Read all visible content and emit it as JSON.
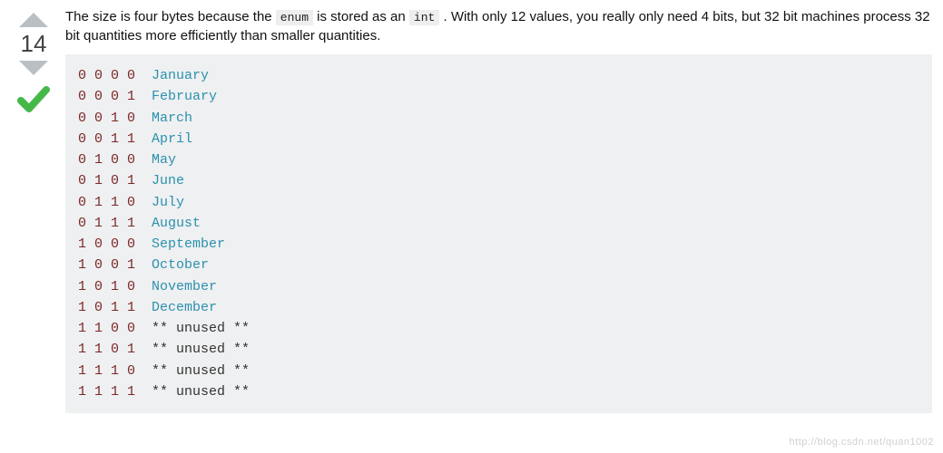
{
  "vote": {
    "score": "14"
  },
  "answer": {
    "text_part1": "The size is four bytes because the ",
    "code1": "enum",
    "text_part2": " is stored as an ",
    "code2": "int",
    "text_part3": " . With only 12 values, you really only need 4 bits, but 32 bit machines process 32 bit quantities more efficiently than smaller quantities."
  },
  "code_rows": [
    {
      "bits": "0 0 0 0  ",
      "label": "January",
      "labelClass": "teal"
    },
    {
      "bits": "0 0 0 1  ",
      "label": "February",
      "labelClass": "teal"
    },
    {
      "bits": "0 0 1 0  ",
      "label": "March",
      "labelClass": "teal"
    },
    {
      "bits": "0 0 1 1  ",
      "label": "April",
      "labelClass": "teal"
    },
    {
      "bits": "0 1 0 0  ",
      "label": "May",
      "labelClass": "teal"
    },
    {
      "bits": "0 1 0 1  ",
      "label": "June",
      "labelClass": "teal"
    },
    {
      "bits": "0 1 1 0  ",
      "label": "July",
      "labelClass": "teal"
    },
    {
      "bits": "0 1 1 1  ",
      "label": "August",
      "labelClass": "teal"
    },
    {
      "bits": "1 0 0 0  ",
      "label": "September",
      "labelClass": "teal"
    },
    {
      "bits": "1 0 0 1  ",
      "label": "October",
      "labelClass": "teal"
    },
    {
      "bits": "1 0 1 0  ",
      "label": "November",
      "labelClass": "teal"
    },
    {
      "bits": "1 0 1 1  ",
      "label": "December",
      "labelClass": "teal"
    },
    {
      "bits": "1 1 0 0  ",
      "label": "** unused **",
      "labelClass": "plain"
    },
    {
      "bits": "1 1 0 1  ",
      "label": "** unused **",
      "labelClass": "plain"
    },
    {
      "bits": "1 1 1 0  ",
      "label": "** unused **",
      "labelClass": "plain"
    },
    {
      "bits": "1 1 1 1  ",
      "label": "** unused **",
      "labelClass": "plain"
    }
  ],
  "watermark": "http://blog.csdn.net/quan1002"
}
